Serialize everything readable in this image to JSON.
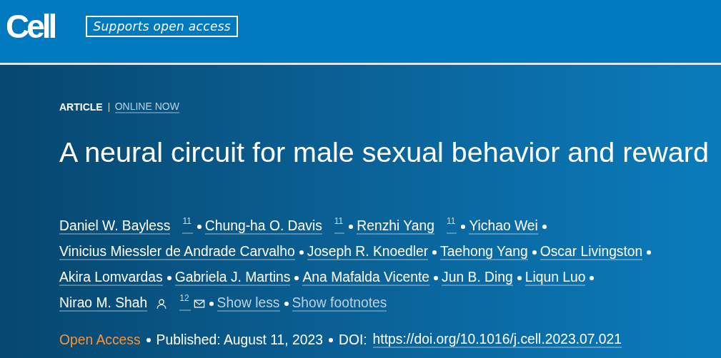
{
  "header": {
    "logo": "Cell",
    "badge": "Supports open access"
  },
  "article": {
    "type": "ARTICLE",
    "status": "ONLINE NOW",
    "title": "A neural circuit for male sexual behavior and reward",
    "author_lines": [
      [
        {
          "name": "Daniel W. Bayless",
          "footnote": "11"
        },
        {
          "name": "Chung-ha O. Davis",
          "footnote": "11"
        },
        {
          "name": "Renzhi Yang",
          "footnote": "11"
        },
        {
          "name": "Yichao Wei"
        }
      ],
      [
        {
          "name": "Vinicius Miessler de Andrade Carvalho"
        },
        {
          "name": "Joseph R. Knoedler"
        },
        {
          "name": "Taehong Yang"
        },
        {
          "name": "Oscar Livingston"
        }
      ],
      [
        {
          "name": "Akira Lomvardas"
        },
        {
          "name": "Gabriela J. Martins"
        },
        {
          "name": "Ana Mafalda Vicente"
        },
        {
          "name": "Jun B. Ding"
        },
        {
          "name": "Liqun Luo"
        }
      ],
      [
        {
          "name": "Nirao M. Shah",
          "corresponding": true,
          "footnote": "12"
        }
      ]
    ],
    "toggles": [
      "Show less",
      "Show footnotes"
    ],
    "access": "Open Access",
    "published": "Published: August 11, 2023",
    "doi_label": "DOI:",
    "doi": "https://doi.org/10.1016/j.cell.2023.07.021"
  }
}
